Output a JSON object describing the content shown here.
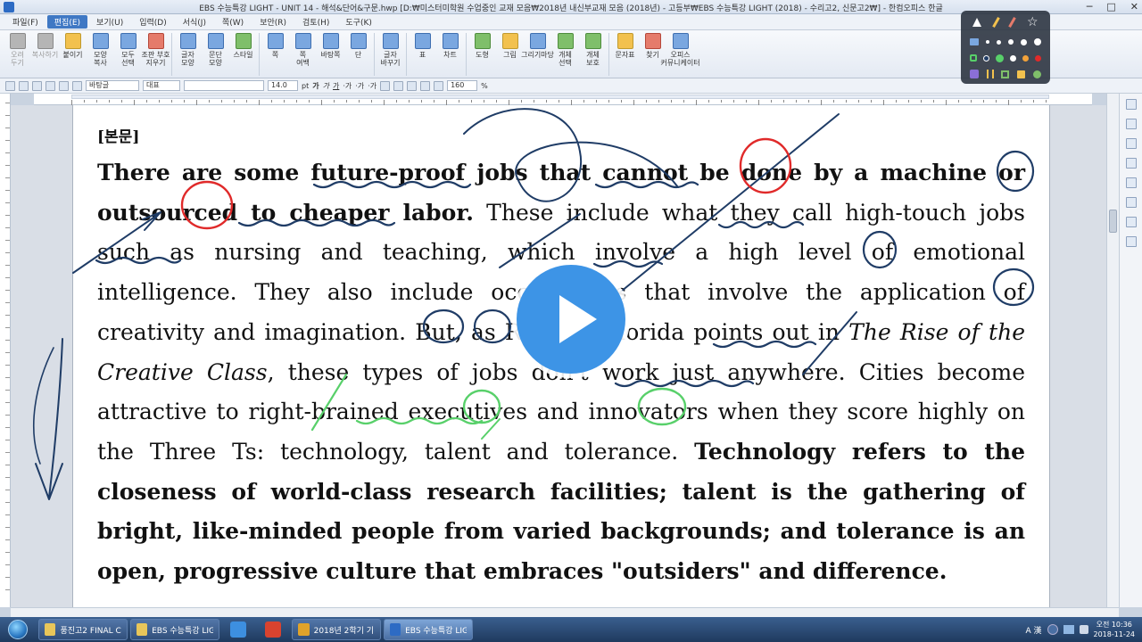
{
  "window": {
    "title": "EBS 수능특강 LIGHT - UNIT 14 - 해석&단어&구문.hwp [D:₩미스터미학원 수업중인 교재 모음₩2018년 내신부교재 모음 (2018년) - 고등부₩EBS 수능특강 LIGHT (2018) - 수리고2, 신문고2₩] - 한컴오피스 한글",
    "controls": [
      "─",
      "□",
      "✕"
    ]
  },
  "menu": [
    "파일(F)",
    "편집(E)",
    "보기(U)",
    "입력(D)",
    "서식(J)",
    "쪽(W)",
    "보안(R)",
    "검토(H)",
    "도구(K)"
  ],
  "menu_active": "편집(E)",
  "ribbon": {
    "groups": [
      [
        {
          "label": "오려\n두기",
          "disabled": true
        },
        {
          "label": "복사하기",
          "disabled": true
        },
        {
          "label": "붙이기"
        },
        {
          "label": "모양\n복사"
        },
        {
          "label": "모두\n선택"
        },
        {
          "label": "조판 부호\n지우기"
        }
      ],
      [
        {
          "label": "글자\n모양"
        },
        {
          "label": "문단\n모양"
        },
        {
          "label": "스타일"
        }
      ],
      [
        {
          "label": "쪽"
        },
        {
          "label": "쪽\n여백"
        },
        {
          "label": "바탕쪽"
        },
        {
          "label": "단"
        }
      ],
      [
        {
          "label": "글자\n바꾸기"
        }
      ],
      [
        {
          "label": "표"
        },
        {
          "label": "차트"
        }
      ],
      [
        {
          "label": "도형"
        },
        {
          "label": "그림"
        },
        {
          "label": "그리기마당"
        },
        {
          "label": "개체\n선택"
        },
        {
          "label": "개체\n보호"
        }
      ],
      [
        {
          "label": "문자표"
        },
        {
          "label": "찾기"
        },
        {
          "label": "오피스\n커뮤니케이터"
        }
      ]
    ]
  },
  "toolbar2": {
    "style": "바탕글",
    "font_lang": "대표",
    "font": "",
    "size": "14.0",
    "size_unit": "pt",
    "format_buttons": [
      "가",
      "가",
      "가",
      "·가",
      "·가",
      "·가"
    ],
    "zoom": "160",
    "zoom_unit": "%"
  },
  "document": {
    "heading": "[본문]",
    "paragraph": [
      {
        "text": "There are some future-proof jobs that cannot be done by a machine or outsourced to cheaper labor.",
        "style": "bold"
      },
      {
        "text": " These include what they call high-touch jobs such as nursing and teaching, which involve a high level of emotional intelligence. They also include occupations that involve the application of creativity and imagination. But, as Richard Florida points out in ",
        "style": "normal"
      },
      {
        "text": "The Rise of the Creative Class",
        "style": "italic"
      },
      {
        "text": ", these types of jobs don't work just anywhere. Cities become attractive to right-brained executives and innovators when they score highly on the Three Ts: technology, talent and tolerance. ",
        "style": "normal"
      },
      {
        "text": "Technology refers to the closeness of world-class research facilities; talent is the gathering of bright, like-minded people from varied backgrounds; and tolerance is an open, progressive culture that embraces \"outsiders\" and difference.",
        "style": "bold"
      }
    ]
  },
  "annotation_colors": {
    "navy": "#1f3c66",
    "red": "#e02a2a",
    "green": "#58d06a"
  },
  "taskbar": {
    "items": [
      {
        "label": "풍진고2 FINAL C...",
        "icon_color": "#e8c65a",
        "kind": "task"
      },
      {
        "label": "EBS 수능특강 LIG...",
        "icon_color": "#e8c65a",
        "kind": "task"
      },
      {
        "label": "",
        "icon_color": "#3d8fe0",
        "kind": "pin"
      },
      {
        "label": "",
        "icon_color": "#d9432f",
        "kind": "pin"
      },
      {
        "label": "2018년 2학기 기...",
        "icon_color": "#e0a32a",
        "kind": "task"
      },
      {
        "label": "EBS 수능특강 LIG...",
        "icon_color": "#2d6bc4",
        "kind": "task",
        "active": true
      }
    ],
    "tray_text": "A 漢",
    "time": "오전 10:36",
    "date": "2018-11-24"
  },
  "play_button": {
    "icon": "play-icon",
    "color": "#3d94e6"
  }
}
